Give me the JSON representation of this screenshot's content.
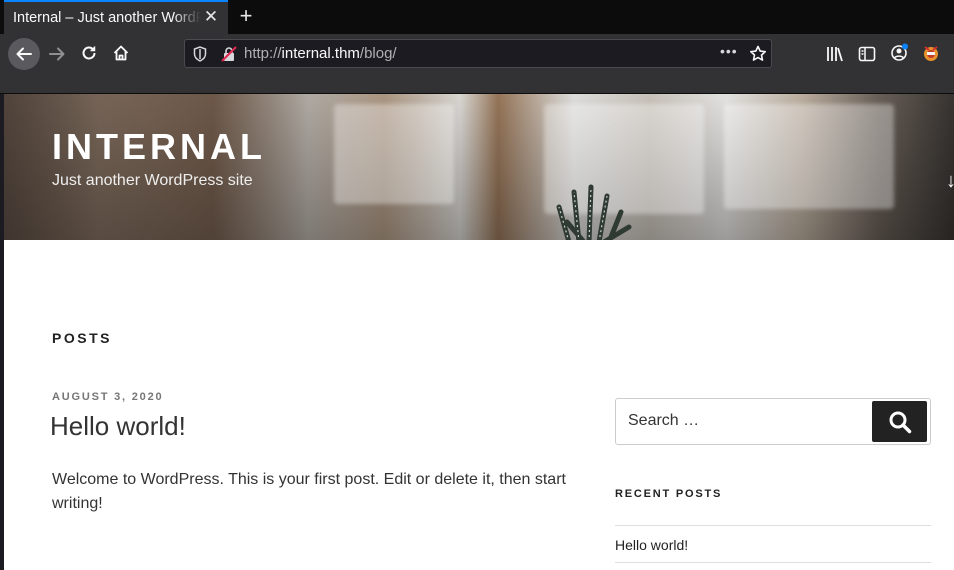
{
  "browser": {
    "tab_title": "Internal – Just another WordPress site",
    "tab_close": "✕",
    "new_tab": "+",
    "url_scheme": "http://",
    "url_host": "internal.thm",
    "url_path": "/blog/",
    "url_more": "•••"
  },
  "site": {
    "title": "INTERNAL",
    "description": "Just another WordPress site"
  },
  "main": {
    "section_heading": "POSTS",
    "posts": [
      {
        "date": "AUGUST 3, 2020",
        "title": "Hello world!",
        "excerpt": "Welcome to WordPress. This is your first post. Edit or delete it, then start writing!"
      }
    ]
  },
  "sidebar": {
    "search_placeholder": "Search …",
    "recent_heading": "RECENT POSTS",
    "recent_posts": [
      "Hello world!"
    ]
  },
  "colors": {
    "tab_accent": "#0a84ff",
    "chrome_bg": "#323234",
    "search_button": "#222222"
  }
}
